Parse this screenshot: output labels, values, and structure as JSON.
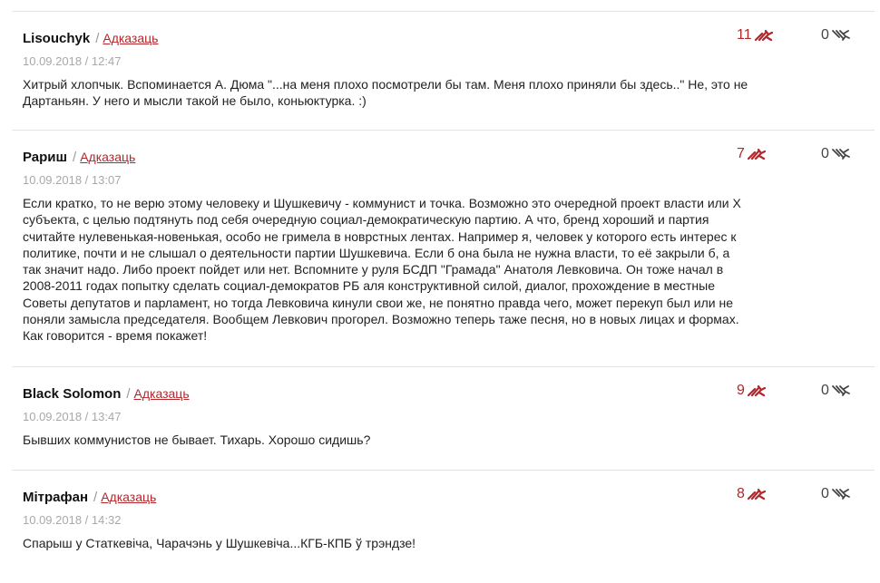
{
  "separator": "/",
  "reply_label": "Адказаць",
  "icons": {
    "up": "thumb-up-bird-icon",
    "down": "thumb-down-bird-icon"
  },
  "colors": {
    "accent": "#b3272b",
    "date": "#a8a8a8",
    "divider": "#e3e3e3"
  },
  "comments": [
    {
      "author": "Lisouchyk",
      "date": "10.09.2018 / 12:47",
      "text": "Хитрый хлопчык. Вспоминается А. Дюма \"...на меня плохо посмотрели бы там. Меня плохо приняли бы здесь..\" Не, это не Дартаньян. У него и мысли такой не было, коньюктурка. :)",
      "likes": "11",
      "dislikes": "0"
    },
    {
      "author": "Рариш",
      "date": "10.09.2018 / 13:07",
      "text": "Если кратко, то не верю этому человеку и Шушкевичу - коммунист и точка. Возможно это очередной проект власти или Х субъекта, с целью подтянуть под себя очередную социал-демократическую партию. А что, бренд хороший и партия считайте нулевенькая-новенькая, особо не гримела в новрстных лентах. Например я, человек у которого есть интерес к политике, почти и не слышал о деятельности партии Шушкевича. Если б она была не нужна власти, то её закрыли б, а так значит надо. Либо проект пойдет или нет. Вспомните у руля БСДП \"Грамада\" Анатоля Левковича. Он тоже начал в 2008-2011 годах попытку сделать социал-демократов РБ аля конструктивной силой, диалог, прохождение в местные Советы депутатов и парламент, но тогда Левковича кинули свои же, не понятно правда чего, может перекуп был или не поняли замысла председателя. Вообщем Левкович прогорел. Возможно теперь таже песня, но в новых лицах и формах. Как говорится - время покажет!",
      "likes": "7",
      "dislikes": "0"
    },
    {
      "author": "Black Solomon",
      "date": "10.09.2018 / 13:47",
      "text": "Бывших коммунистов не бывает. Тихарь. Хорошо сидишь?",
      "likes": "9",
      "dislikes": "0"
    },
    {
      "author": "Мітрафан",
      "date": "10.09.2018 / 14:32",
      "text": "Спарыш у Статкевіча, Чарачэнь у Шушкевіча...КГБ-КПБ ў трэндзе!",
      "likes": "8",
      "dislikes": "0"
    }
  ]
}
